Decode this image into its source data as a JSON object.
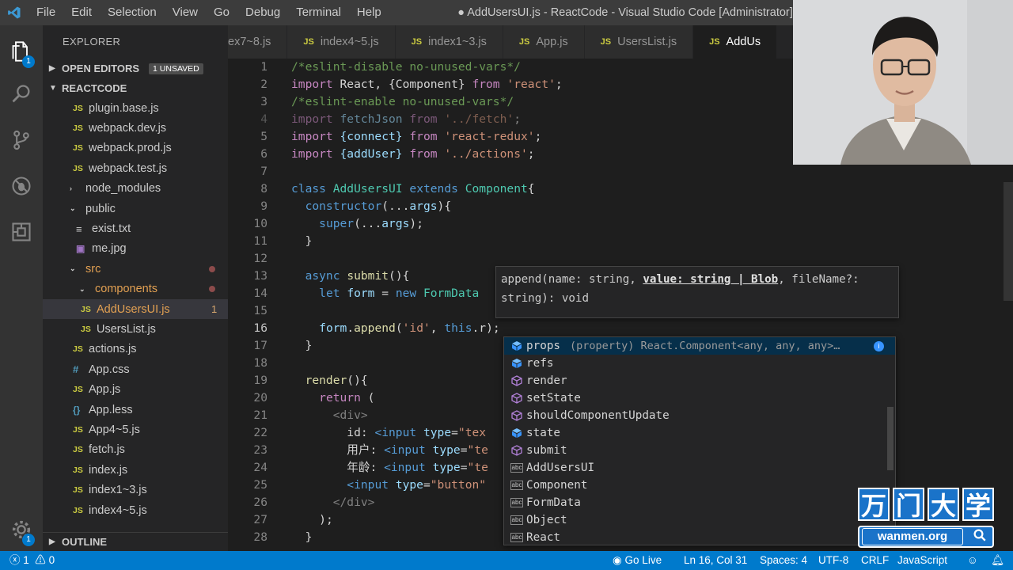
{
  "titlebar": {
    "menu": [
      "File",
      "Edit",
      "Selection",
      "View",
      "Go",
      "Debug",
      "Terminal",
      "Help"
    ],
    "window_title": "● AddUsersUI.js - ReactCode - Visual Studio Code [Administrator]"
  },
  "activity": {
    "explorer_badge": "1",
    "settings_badge": "1"
  },
  "sidebar": {
    "title": "EXPLORER",
    "open_editors": {
      "label": "OPEN EDITORS",
      "badge": "1 UNSAVED"
    },
    "project": "REACTCODE",
    "files": [
      {
        "name": "plugin.base.js",
        "icon": "JS"
      },
      {
        "name": "webpack.dev.js",
        "icon": "JS"
      },
      {
        "name": "webpack.prod.js",
        "icon": "JS"
      },
      {
        "name": "webpack.test.js",
        "icon": "JS"
      },
      {
        "name": "node_modules",
        "icon": "›"
      },
      {
        "name": "public",
        "icon": "⌄"
      },
      {
        "name": "exist.txt",
        "icon": "≡"
      },
      {
        "name": "me.jpg",
        "icon": "▣"
      },
      {
        "name": "src",
        "icon": "⌄"
      },
      {
        "name": "components",
        "icon": "⌄"
      },
      {
        "name": "AddUsersUI.js",
        "icon": "JS",
        "errors": "1"
      },
      {
        "name": "UsersList.js",
        "icon": "JS"
      },
      {
        "name": "actions.js",
        "icon": "JS"
      },
      {
        "name": "App.css",
        "icon": "#"
      },
      {
        "name": "App.js",
        "icon": "JS"
      },
      {
        "name": "App.less",
        "icon": "{}"
      },
      {
        "name": "App4~5.js",
        "icon": "JS"
      },
      {
        "name": "fetch.js",
        "icon": "JS"
      },
      {
        "name": "index.js",
        "icon": "JS"
      },
      {
        "name": "index1~3.js",
        "icon": "JS"
      },
      {
        "name": "index4~5.js",
        "icon": "JS"
      }
    ],
    "outline": "OUTLINE"
  },
  "tabs": [
    {
      "label": "ex7~8.js"
    },
    {
      "label": "index4~5.js"
    },
    {
      "label": "index1~3.js"
    },
    {
      "label": "App.js"
    },
    {
      "label": "UsersList.js"
    },
    {
      "label": "AddUs"
    }
  ],
  "tab_icon": "JS",
  "editor": {
    "line_numbers": [
      "1",
      "2",
      "3",
      "4",
      "5",
      "6",
      "7",
      "8",
      "9",
      "10",
      "11",
      "12",
      "13",
      "14",
      "15",
      "16",
      "17",
      "18",
      "19",
      "20",
      "21",
      "22",
      "23",
      "24",
      "25",
      "26",
      "27",
      "28"
    ],
    "lines": {
      "l1": "/*eslint-disable no-unused-vars*/",
      "l2a": "import",
      "l2b": " React, {Component} ",
      "l2c": "from",
      "l2d": "'react'",
      "l2e": ";",
      "l3": "/*eslint-enable no-unused-vars*/",
      "l4a": "import",
      "l4b": " fetchJson ",
      "l4c": "from",
      "l4d": "'../fetch'",
      "l4e": ";",
      "l5a": "import",
      "l5b": " {connect} ",
      "l5c": "from",
      "l5d": "'react-redux'",
      "l5e": ";",
      "l6a": "import",
      "l6b": " {addUser} ",
      "l6c": "from",
      "l6d": "'../actions'",
      "l6e": ";",
      "l8a": "class",
      "l8b": "AddUsersUI",
      "l8c": "extends",
      "l8d": "Component",
      "l8e": "{",
      "l9a": "constructor",
      "l9b": "(...",
      "l9c": "args",
      "l9d": "){",
      "l10a": "super",
      "l10b": "(...",
      "l10c": "args",
      "l10d": ");",
      "l11": "}",
      "l13a": "async",
      "l13b": "submit",
      "l13c": "(){",
      "l14a": "let",
      "l14b": "form",
      "l14c": " = ",
      "l14d": "new",
      "l14e": "FormData",
      "l16a": "form",
      "l16b": ".",
      "l16c": "append",
      "l16d": "(",
      "l16e": "'id'",
      "l16f": ", ",
      "l16g": "this",
      "l16h": ".r",
      "l16i": ");",
      "l17": "}",
      "l19a": "render",
      "l19b": "(){",
      "l20a": "return",
      "l20b": " (",
      "l21a": "<div>",
      "l22a": "id: ",
      "l22b": "<input",
      "l22c": "type",
      "l22d": "=",
      "l22e": "\"tex",
      "l23a": "用户: ",
      "l23b": "<input",
      "l23c": "type",
      "l23d": "=",
      "l23e": "\"te",
      "l24a": "年龄: ",
      "l24b": "<input",
      "l24c": "type",
      "l24d": "=",
      "l24e": "\"te",
      "l25a": "<input",
      "l25b": "type",
      "l25c": "=",
      "l25d": "\"button\"",
      "l26": "</div>",
      "l27": ");",
      "l28": "}"
    }
  },
  "param_hint": {
    "pre": "append(name: string, ",
    "active": "value: string | Blob",
    "post": ", fileName?:",
    "line2": "string): void"
  },
  "suggestions": [
    {
      "label": "props",
      "detail": "(property) React.Component<any, any, any>…",
      "kind": "property"
    },
    {
      "label": "refs",
      "kind": "property"
    },
    {
      "label": "render",
      "kind": "method"
    },
    {
      "label": "setState",
      "kind": "method"
    },
    {
      "label": "shouldComponentUpdate",
      "kind": "method"
    },
    {
      "label": "state",
      "kind": "property"
    },
    {
      "label": "submit",
      "kind": "method"
    },
    {
      "label": "AddUsersUI",
      "kind": "text"
    },
    {
      "label": "Component",
      "kind": "text"
    },
    {
      "label": "FormData",
      "kind": "text"
    },
    {
      "label": "Object",
      "kind": "text"
    },
    {
      "label": "React",
      "kind": "text"
    }
  ],
  "abc_label": "abc",
  "info_label": "i",
  "watermark": {
    "chars": [
      "万",
      "门",
      "大",
      "学"
    ],
    "site": "wanmen.org"
  },
  "statusbar": {
    "errors": "1",
    "warnings": "0",
    "go_live": "Go Live",
    "position": "Ln 16, Col 31",
    "spaces": "Spaces: 4",
    "encoding": "UTF-8",
    "eol": "CRLF",
    "language": "JavaScript"
  },
  "colors": {
    "accent": "#007acc",
    "editor_bg": "#1e1e1e",
    "sidebar_bg": "#252526",
    "activity_bg": "#333333"
  }
}
